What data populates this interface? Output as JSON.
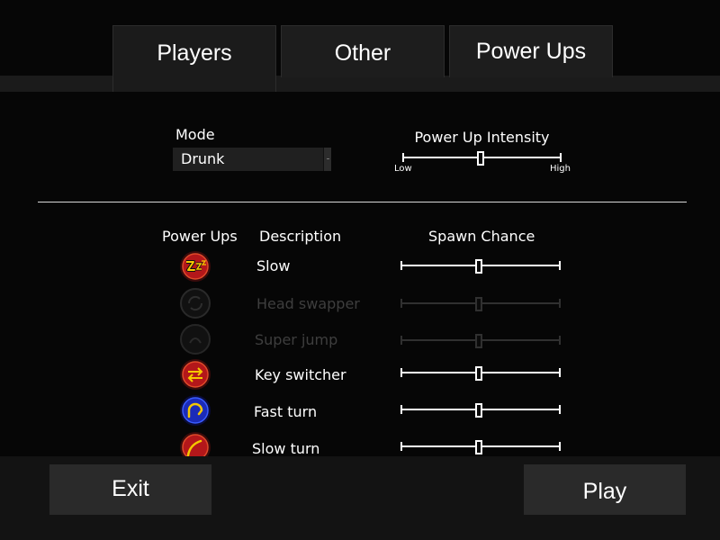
{
  "tabs": [
    {
      "label": "Players",
      "active": true
    },
    {
      "label": "Other",
      "active": false
    },
    {
      "label": "Power Ups",
      "active": false
    }
  ],
  "settings": {
    "mode_label": "Mode",
    "mode_value": "Drunk",
    "intensity_label": "Power Up Intensity",
    "intensity_low": "Low",
    "intensity_high": "High",
    "intensity_value": 0.49
  },
  "powerups_table": {
    "header_powerups": "Power Ups",
    "header_description": "Description",
    "header_spawn": "Spawn Chance",
    "items": [
      {
        "name": "Slow",
        "icon": "zzz-icon",
        "enabled": true,
        "spawn_chance": 0.49
      },
      {
        "name": "Head swapper",
        "icon": "swap-circle-icon",
        "enabled": false,
        "spawn_chance": 0.49
      },
      {
        "name": "Super jump",
        "icon": "jump-icon",
        "enabled": false,
        "spawn_chance": 0.49
      },
      {
        "name": "Key switcher",
        "icon": "arrows-switch-icon",
        "enabled": true,
        "spawn_chance": 0.49
      },
      {
        "name": "Fast turn",
        "icon": "sharp-turn-icon",
        "enabled": true,
        "spawn_chance": 0.49
      },
      {
        "name": "Slow turn",
        "icon": "wide-turn-icon",
        "enabled": true,
        "spawn_chance": 0.49
      }
    ]
  },
  "buttons": {
    "exit_label": "Exit",
    "play_label": "Play"
  },
  "colors": {
    "background": "#060606",
    "panel": "#1b1b1b",
    "button": "#2a2a2a",
    "red_icon": "#b3171a",
    "blue_icon": "#1b2bb8",
    "icon_yellow": "#f5c800"
  }
}
